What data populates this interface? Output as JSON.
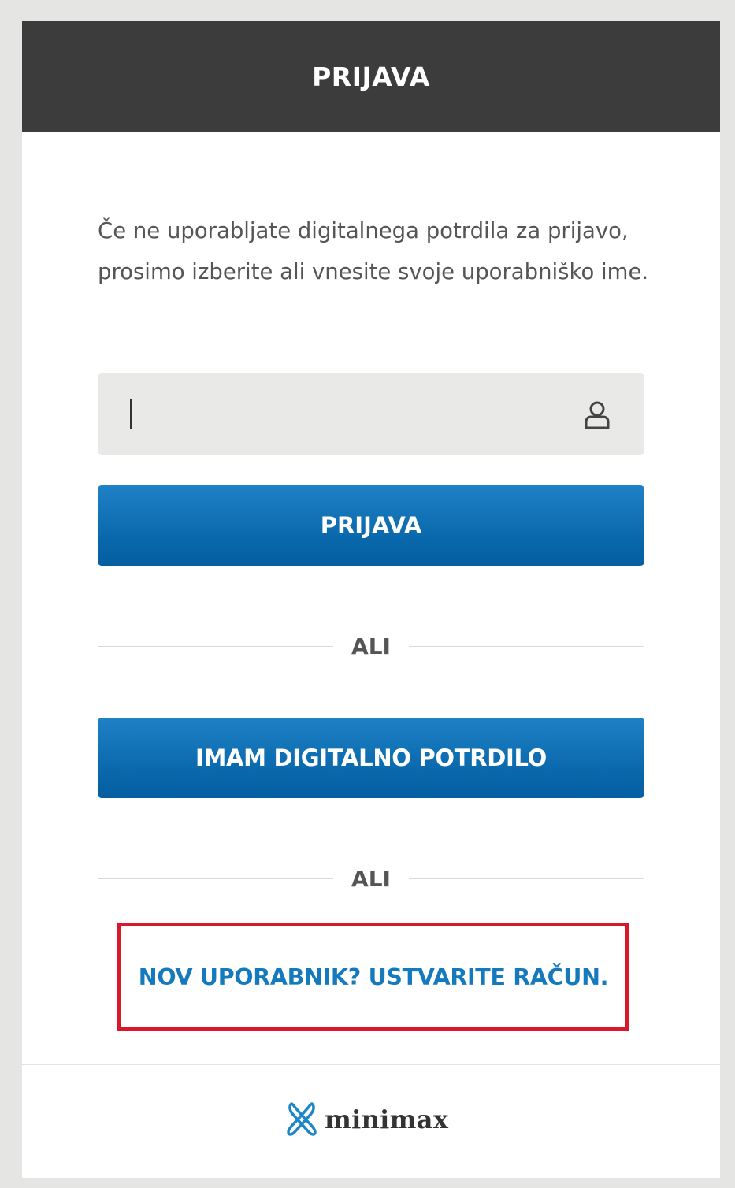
{
  "header": {
    "title": "PRIJAVA"
  },
  "intro_text": "Če ne uporabljate digitalnega potrdila za prijavo, prosimo izberite ali vnesite svoje uporabniško ime.",
  "username_input": {
    "value": "",
    "icon": "user-icon"
  },
  "login_button": {
    "label": "PRIJAVA"
  },
  "divider_1": {
    "label": "ALI"
  },
  "certificate_button": {
    "label": "IMAM DIGITALNO POTRDILO"
  },
  "divider_2": {
    "label": "ALI"
  },
  "signup": {
    "label": "NOV UPORABNIK? USTVARITE RAČUN."
  },
  "footer": {
    "logo_text": "minimax",
    "logo_icon": "minimax-logo-icon"
  },
  "colors": {
    "header_bg": "#3c3c3c",
    "button_blue": "#0867aa",
    "link_blue": "#1479bd",
    "highlight_red": "#d7192b",
    "input_bg": "#e9e9e7",
    "page_bg": "#e5e5e3"
  }
}
